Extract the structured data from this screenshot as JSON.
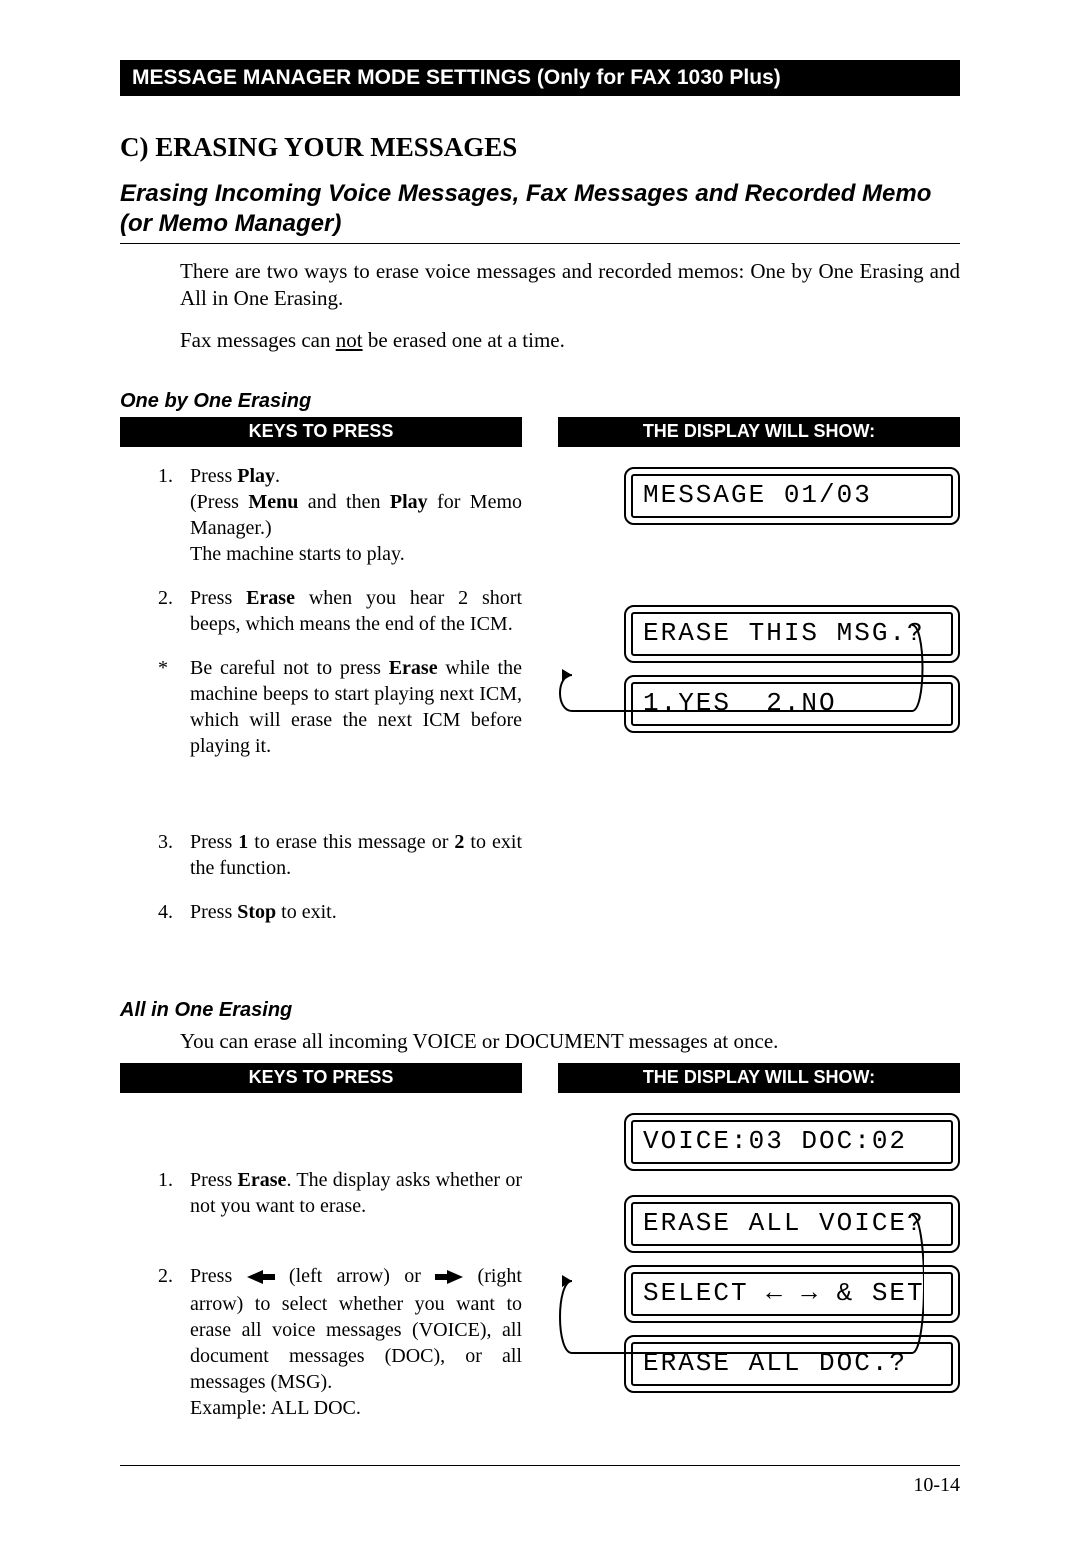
{
  "chapter_bar": "MESSAGE MANAGER MODE SETTINGS (Only for FAX 1030 Plus)",
  "section_title": "C) ERASING YOUR MESSAGES",
  "subsection_title": "Erasing Incoming Voice Messages, Fax Messages and Recorded Memo (or Memo Manager)",
  "intro_para": "There are two ways to erase voice messages and recorded memos: One by One Erasing and All in One Erasing.",
  "fax_para_pre": "Fax messages can ",
  "fax_para_underline": "not",
  "fax_para_post": " be erased one at a time.",
  "one_by_one": {
    "title": "One by One Erasing",
    "keys_header": "KEYS TO PRESS",
    "display_header": "THE DISPLAY WILL SHOW:",
    "step1_a": "Press ",
    "step1_b": "Play",
    "step1_c": ".",
    "step1_d": "(Press ",
    "step1_e": "Menu",
    "step1_f": " and then ",
    "step1_g": "Play",
    "step1_h": " for Memo Manager.)",
    "step1_i": "The machine starts to play.",
    "step2_a": "Press ",
    "step2_b": "Erase",
    "step2_c": " when you hear 2 short beeps, which means the end of the ICM.",
    "step2n_a": "Be careful not to press ",
    "step2n_b": "Erase",
    "step2n_c": " while the machine beeps to start playing next ICM, which will erase the next ICM before playing it.",
    "step3_a": "Press ",
    "step3_b": "1",
    "step3_c": " to erase this message or ",
    "step3_d": "2",
    "step3_e": " to exit the function.",
    "step4_a": "Press ",
    "step4_b": "Stop",
    "step4_c": " to exit.",
    "lcd1": "MESSAGE 01/03",
    "lcd2a": "ERASE THIS MSG.?",
    "lcd2b": "1.YES  2.NO"
  },
  "all_in_one": {
    "title": "All in One Erasing",
    "intro": "You can erase all incoming VOICE or DOCUMENT messages at once.",
    "keys_header": "KEYS TO PRESS",
    "display_header": "THE DISPLAY WILL SHOW:",
    "step1_a": "Press ",
    "step1_b": "Erase",
    "step1_c": ". The display asks whether or not you want to erase.",
    "step2_a": "Press ",
    "step2_b": " (left arrow) or ",
    "step2_c": " (right arrow) to select whether you want to erase all voice messages (VOICE), all document messages (DOC), or all messages (MSG).",
    "step2_d": "Example: ALL DOC.",
    "lcd1": "VOICE:03 DOC:02",
    "lcd2": "ERASE ALL VOICE?",
    "lcd3": "SELECT ← → & SET",
    "lcd4": "ERASE ALL DOC.?"
  },
  "page_number": "10-14"
}
